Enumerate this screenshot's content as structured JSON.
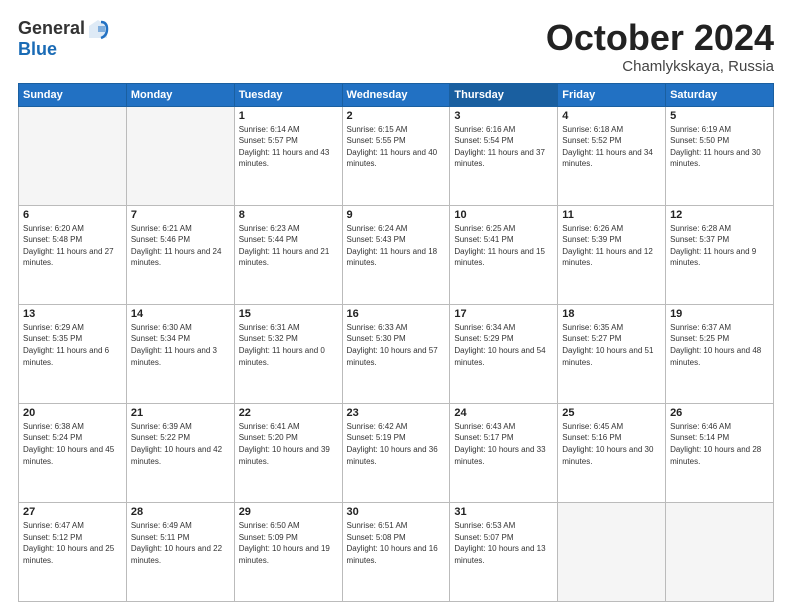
{
  "header": {
    "logo_general": "General",
    "logo_blue": "Blue",
    "month": "October 2024",
    "location": "Chamlykskaya, Russia"
  },
  "weekdays": [
    "Sunday",
    "Monday",
    "Tuesday",
    "Wednesday",
    "Thursday",
    "Friday",
    "Saturday"
  ],
  "weeks": [
    [
      {
        "day": "",
        "info": ""
      },
      {
        "day": "",
        "info": ""
      },
      {
        "day": "1",
        "info": "Sunrise: 6:14 AM\nSunset: 5:57 PM\nDaylight: 11 hours and 43 minutes."
      },
      {
        "day": "2",
        "info": "Sunrise: 6:15 AM\nSunset: 5:55 PM\nDaylight: 11 hours and 40 minutes."
      },
      {
        "day": "3",
        "info": "Sunrise: 6:16 AM\nSunset: 5:54 PM\nDaylight: 11 hours and 37 minutes."
      },
      {
        "day": "4",
        "info": "Sunrise: 6:18 AM\nSunset: 5:52 PM\nDaylight: 11 hours and 34 minutes."
      },
      {
        "day": "5",
        "info": "Sunrise: 6:19 AM\nSunset: 5:50 PM\nDaylight: 11 hours and 30 minutes."
      }
    ],
    [
      {
        "day": "6",
        "info": "Sunrise: 6:20 AM\nSunset: 5:48 PM\nDaylight: 11 hours and 27 minutes."
      },
      {
        "day": "7",
        "info": "Sunrise: 6:21 AM\nSunset: 5:46 PM\nDaylight: 11 hours and 24 minutes."
      },
      {
        "day": "8",
        "info": "Sunrise: 6:23 AM\nSunset: 5:44 PM\nDaylight: 11 hours and 21 minutes."
      },
      {
        "day": "9",
        "info": "Sunrise: 6:24 AM\nSunset: 5:43 PM\nDaylight: 11 hours and 18 minutes."
      },
      {
        "day": "10",
        "info": "Sunrise: 6:25 AM\nSunset: 5:41 PM\nDaylight: 11 hours and 15 minutes."
      },
      {
        "day": "11",
        "info": "Sunrise: 6:26 AM\nSunset: 5:39 PM\nDaylight: 11 hours and 12 minutes."
      },
      {
        "day": "12",
        "info": "Sunrise: 6:28 AM\nSunset: 5:37 PM\nDaylight: 11 hours and 9 minutes."
      }
    ],
    [
      {
        "day": "13",
        "info": "Sunrise: 6:29 AM\nSunset: 5:35 PM\nDaylight: 11 hours and 6 minutes."
      },
      {
        "day": "14",
        "info": "Sunrise: 6:30 AM\nSunset: 5:34 PM\nDaylight: 11 hours and 3 minutes."
      },
      {
        "day": "15",
        "info": "Sunrise: 6:31 AM\nSunset: 5:32 PM\nDaylight: 11 hours and 0 minutes."
      },
      {
        "day": "16",
        "info": "Sunrise: 6:33 AM\nSunset: 5:30 PM\nDaylight: 10 hours and 57 minutes."
      },
      {
        "day": "17",
        "info": "Sunrise: 6:34 AM\nSunset: 5:29 PM\nDaylight: 10 hours and 54 minutes."
      },
      {
        "day": "18",
        "info": "Sunrise: 6:35 AM\nSunset: 5:27 PM\nDaylight: 10 hours and 51 minutes."
      },
      {
        "day": "19",
        "info": "Sunrise: 6:37 AM\nSunset: 5:25 PM\nDaylight: 10 hours and 48 minutes."
      }
    ],
    [
      {
        "day": "20",
        "info": "Sunrise: 6:38 AM\nSunset: 5:24 PM\nDaylight: 10 hours and 45 minutes."
      },
      {
        "day": "21",
        "info": "Sunrise: 6:39 AM\nSunset: 5:22 PM\nDaylight: 10 hours and 42 minutes."
      },
      {
        "day": "22",
        "info": "Sunrise: 6:41 AM\nSunset: 5:20 PM\nDaylight: 10 hours and 39 minutes."
      },
      {
        "day": "23",
        "info": "Sunrise: 6:42 AM\nSunset: 5:19 PM\nDaylight: 10 hours and 36 minutes."
      },
      {
        "day": "24",
        "info": "Sunrise: 6:43 AM\nSunset: 5:17 PM\nDaylight: 10 hours and 33 minutes."
      },
      {
        "day": "25",
        "info": "Sunrise: 6:45 AM\nSunset: 5:16 PM\nDaylight: 10 hours and 30 minutes."
      },
      {
        "day": "26",
        "info": "Sunrise: 6:46 AM\nSunset: 5:14 PM\nDaylight: 10 hours and 28 minutes."
      }
    ],
    [
      {
        "day": "27",
        "info": "Sunrise: 6:47 AM\nSunset: 5:12 PM\nDaylight: 10 hours and 25 minutes."
      },
      {
        "day": "28",
        "info": "Sunrise: 6:49 AM\nSunset: 5:11 PM\nDaylight: 10 hours and 22 minutes."
      },
      {
        "day": "29",
        "info": "Sunrise: 6:50 AM\nSunset: 5:09 PM\nDaylight: 10 hours and 19 minutes."
      },
      {
        "day": "30",
        "info": "Sunrise: 6:51 AM\nSunset: 5:08 PM\nDaylight: 10 hours and 16 minutes."
      },
      {
        "day": "31",
        "info": "Sunrise: 6:53 AM\nSunset: 5:07 PM\nDaylight: 10 hours and 13 minutes."
      },
      {
        "day": "",
        "info": ""
      },
      {
        "day": "",
        "info": ""
      }
    ]
  ]
}
